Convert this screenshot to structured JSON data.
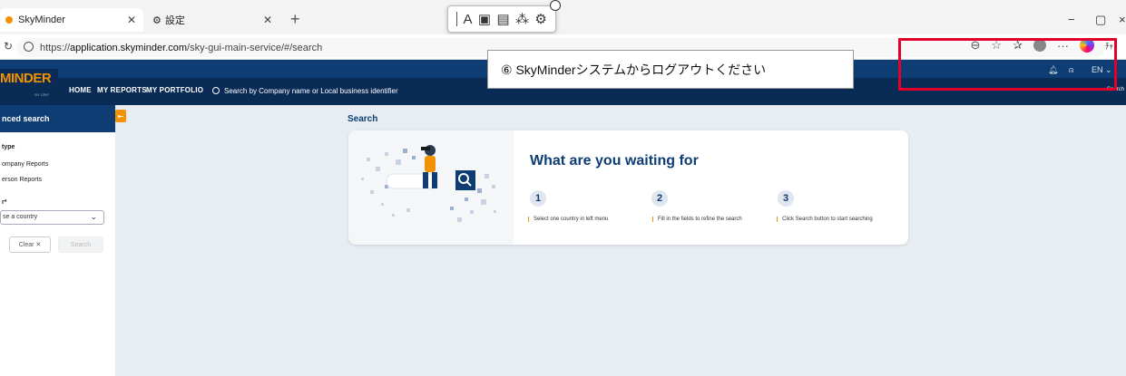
{
  "browser": {
    "tabs": [
      {
        "title": "SkyMinder",
        "active": true
      },
      {
        "title": "設定",
        "active": false
      }
    ],
    "url_prefix": "https://",
    "url_host": "application.skyminder.com",
    "url_path": "/sky-gui-main-service/#/search",
    "window_controls": [
      "−",
      "▢",
      "×"
    ],
    "addr_cut_text": "ﾁｬ"
  },
  "app": {
    "logo": "MINDER",
    "logo_by": "BY CRIF",
    "nav": [
      "HOME",
      "MY REPORTS",
      "MY PORTFOLIO"
    ],
    "search_placeholder": "Search by Company name or Local business identifier",
    "language": "EN",
    "edge_label": "Search"
  },
  "callout": {
    "text": "⑥ SkyMinderシステムからログアウトください"
  },
  "sidebar": {
    "title": "nced search",
    "type_label": "type",
    "options": [
      "ompany Reports",
      "erson Reports"
    ],
    "country_label": "r*",
    "country_placeholder": "se a country",
    "clear_label": "Clear ✕",
    "search_label": "Search"
  },
  "main": {
    "title": "Search",
    "heading": "What are you waiting for",
    "steps": [
      {
        "num": "1",
        "text": "Select one country in left menu"
      },
      {
        "num": "2",
        "text": "Fill in the fields to refine the search"
      },
      {
        "num": "3",
        "text": "Click Search button to start searching"
      }
    ]
  },
  "colors": {
    "brand_navy": "#0d3d73",
    "brand_orange": "#f39200",
    "highlight_red": "#e3002b"
  }
}
